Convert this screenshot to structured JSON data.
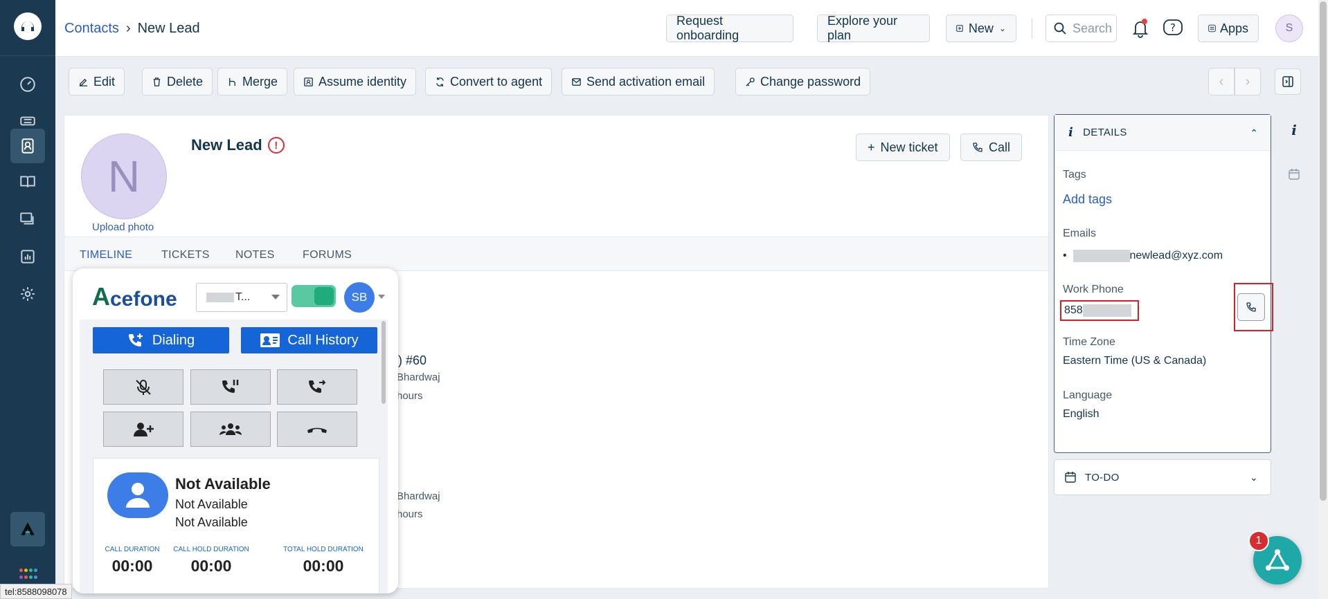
{
  "breadcrumb": {
    "parent": "Contacts",
    "current": "New Lead"
  },
  "topbar": {
    "request_onboarding": "Request onboarding",
    "explore_plan": "Explore your plan",
    "new_label": "New",
    "search_placeholder": "Search",
    "apps_label": "Apps",
    "user_initial": "S"
  },
  "actions": {
    "edit": "Edit",
    "delete": "Delete",
    "merge": "Merge",
    "assume_identity": "Assume identity",
    "convert_to_agent": "Convert to agent",
    "send_activation_email": "Send activation email",
    "change_password": "Change password"
  },
  "contact": {
    "initial": "N",
    "upload_photo": "Upload photo",
    "name": "New Lead",
    "warning_glyph": "!",
    "new_ticket": "New ticket",
    "call": "Call"
  },
  "tabs": [
    "TIMELINE",
    "TICKETS",
    "NOTES",
    "FORUMS"
  ],
  "timeline_fragments": {
    "ticket_ref": "l) #60",
    "agent_1": "Bhardwaj",
    "time_1": "hours",
    "agent_2": "Bhardwaj",
    "time_2": "hours"
  },
  "details": {
    "header": "DETAILS",
    "tags_label": "Tags",
    "add_tags": "Add tags",
    "emails_label": "Emails",
    "email_suffix": "newlead@xyz.com",
    "work_phone_label": "Work Phone",
    "work_phone_prefix": "858",
    "time_zone_label": "Time Zone",
    "time_zone": "Eastern Time (US & Canada)",
    "language_label": "Language",
    "language": "English"
  },
  "todo": {
    "label": "TO-DO"
  },
  "widget": {
    "brand_a": "A",
    "brand_rest": "cefone",
    "number_partial": "T...",
    "agent_initials": "SB",
    "dialing": "Dialing",
    "call_history": "Call History",
    "status_title": "Not Available",
    "status_line_1": "Not Available",
    "status_line_2": "Not Available",
    "call_duration_label": "CALL DURATION",
    "call_hold_duration_label": "CALL HOLD DURATION",
    "total_hold_duration_label": "TOTAL HOLD DURATION",
    "call_duration": "00:00",
    "call_hold_duration": "00:00",
    "total_hold_duration": "00:00"
  },
  "chat": {
    "badge_count": "1"
  },
  "status_bar": {
    "link": "tel:8588098078"
  },
  "colors": {
    "sidebar": "#1b3a52",
    "accent": "#2c5cc5",
    "acefone_blue": "#1565d8",
    "highlight_red": "#d91f26"
  }
}
